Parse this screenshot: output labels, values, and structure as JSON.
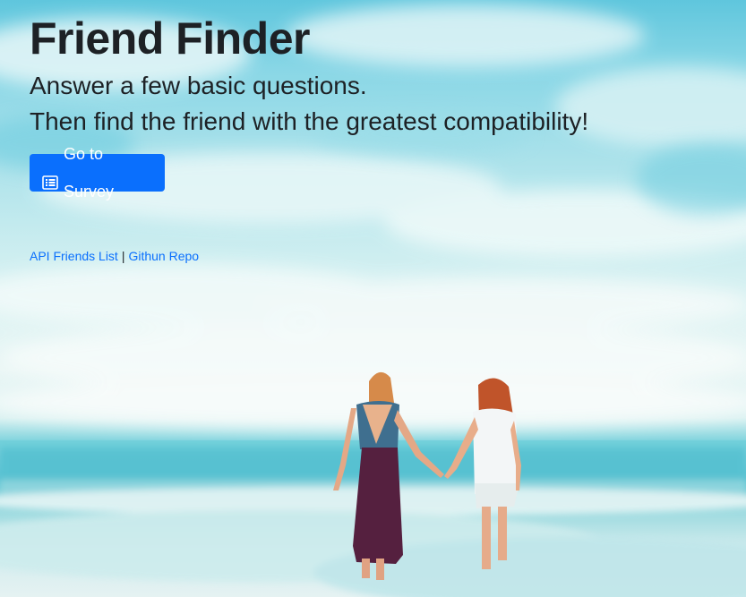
{
  "header": {
    "title": "Friend Finder",
    "subtitle_line1": "Answer a few basic questions.",
    "subtitle_line2": "Then find the friend with the greatest compatibility!"
  },
  "actions": {
    "survey_button_label": "Go to Survey",
    "survey_button_icon": "list-alt-icon"
  },
  "footer_links": {
    "api_link": "API Friends List",
    "separator": "|",
    "repo_link": "Githun Repo"
  },
  "colors": {
    "primary": "#0a6ffd",
    "text": "#1d2125",
    "sky": "#8ad7e6",
    "sea": "#59c3d3"
  }
}
